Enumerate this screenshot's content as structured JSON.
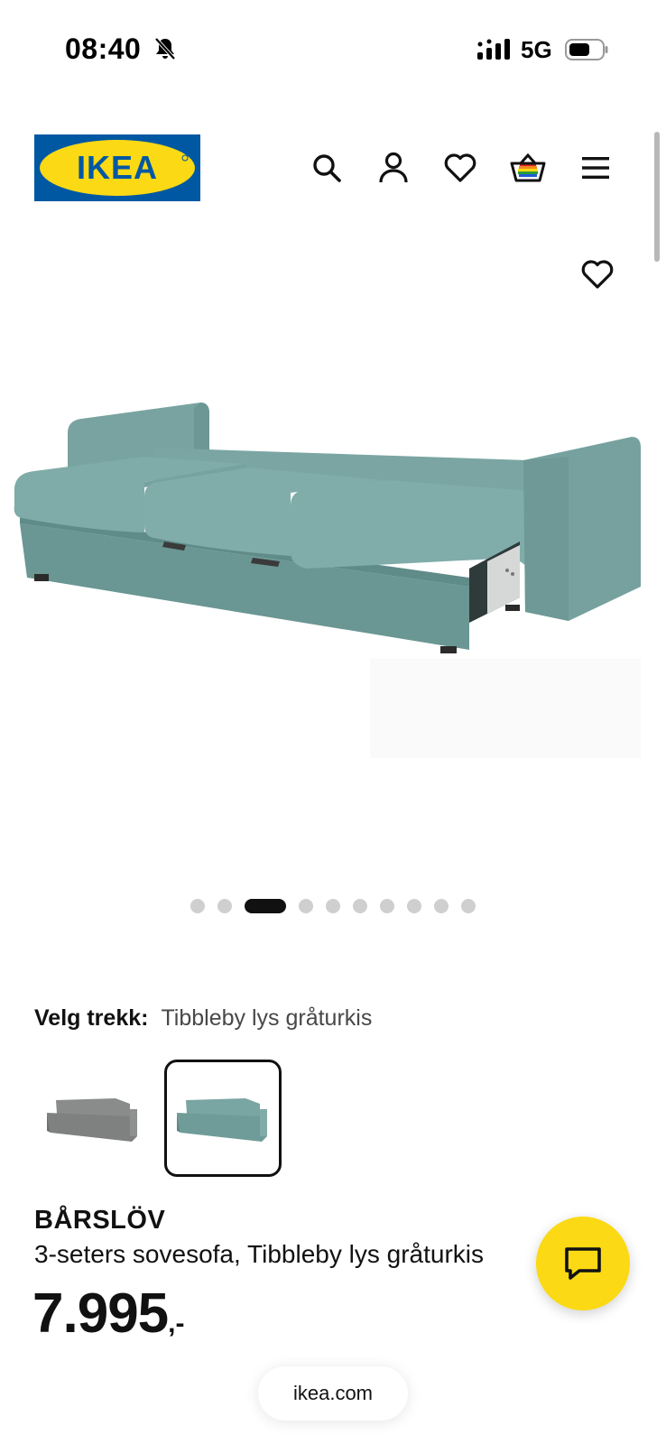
{
  "status_bar": {
    "time": "08:40",
    "network": "5G",
    "icons": [
      "bell-muted-icon",
      "signal-icon",
      "battery-icon"
    ]
  },
  "header": {
    "logo_text": "IKEA",
    "icons": [
      "search-icon",
      "account-icon",
      "favorites-icon",
      "basket-icon",
      "menu-icon"
    ]
  },
  "gallery": {
    "image_count": 10,
    "active_index": 2
  },
  "cover": {
    "label": "Velg trekk:",
    "value": "Tibbleby lys gråturkis",
    "options_count": 2,
    "selected_index": 1
  },
  "product": {
    "name": "BÅRSLÖV",
    "description": "3-seters sovesofa, Tibbleby lys gråturkis",
    "price_number": "7.995",
    "price_suffix": ",-"
  },
  "browser": {
    "url": "ikea.com"
  },
  "colors": {
    "ikea_blue": "#0058a3",
    "ikea_yellow": "#fbd914",
    "sofa_teal": "#6f9c98",
    "sofa_grey": "#7f8080"
  }
}
